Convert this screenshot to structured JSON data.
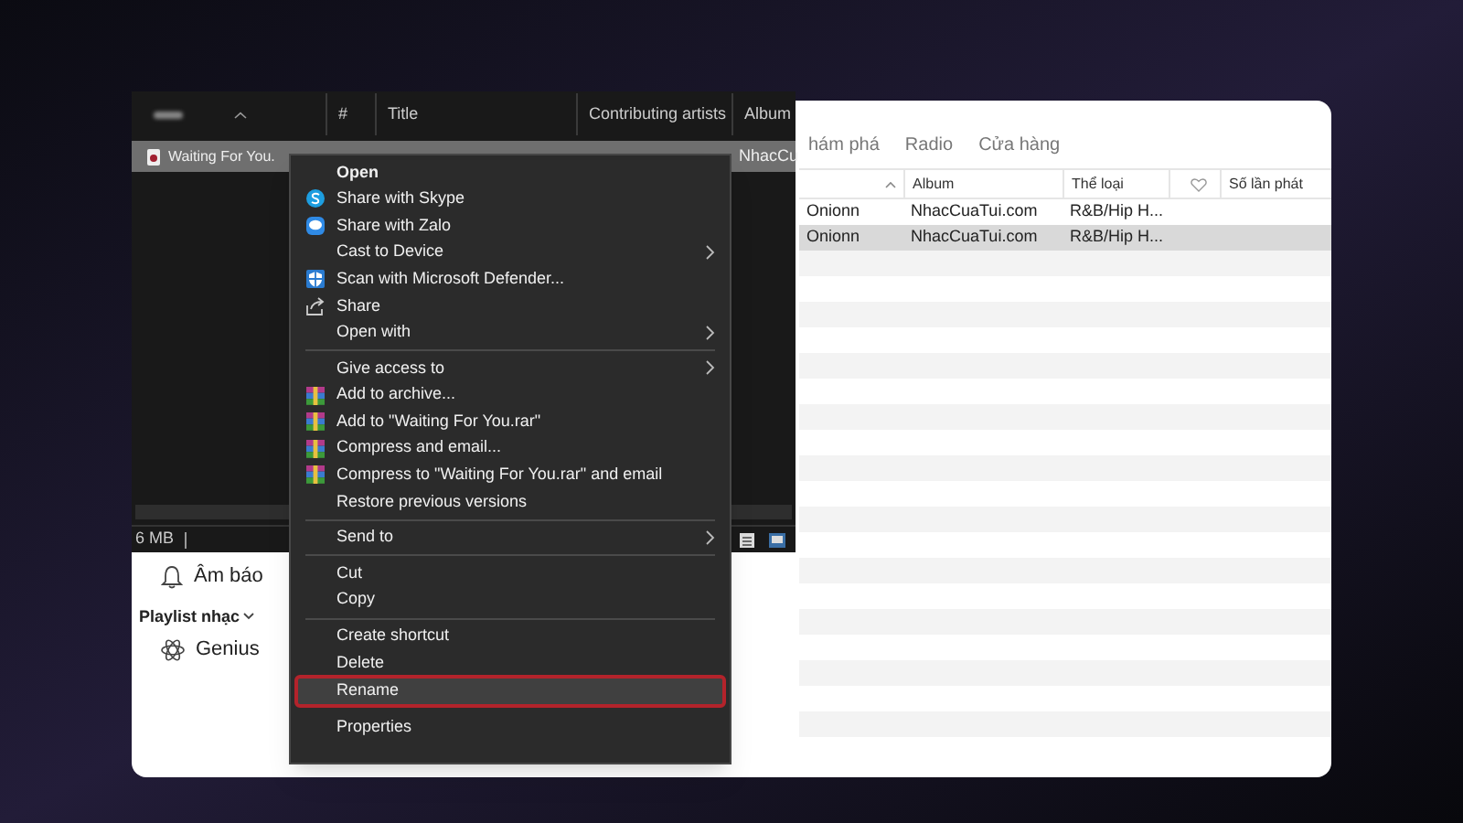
{
  "music_app": {
    "tabs": [
      {
        "label": "hám phá",
        "selected": false
      },
      {
        "label": "Radio",
        "selected": false
      },
      {
        "label": "Cửa hàng",
        "selected": false
      }
    ],
    "columns": [
      {
        "kind": "sort"
      },
      {
        "label": "Album",
        "kind": "text"
      },
      {
        "label": "Thể loại",
        "kind": "text"
      },
      {
        "kind": "heart"
      },
      {
        "label": "Số lần phát",
        "kind": "text"
      }
    ],
    "rows": [
      {
        "cells": [
          "Onionn",
          "NhacCuaTui.com",
          "R&B/Hip H..."
        ],
        "selected": false
      },
      {
        "cells": [
          "Onionn",
          "NhacCuaTui.com",
          "R&B/Hip H..."
        ],
        "selected": true
      }
    ],
    "sidebar": [
      {
        "kind": "alert_item",
        "label": "Âm báo"
      },
      {
        "kind": "heading",
        "label": "Playlist nhạc"
      },
      {
        "kind": "playlist_item",
        "label": "Genius"
      }
    ]
  },
  "explorer": {
    "columns": [
      "#",
      "Title",
      "Contributing artists",
      "Album"
    ],
    "file": {
      "name": "Waiting For You.",
      "album": "NhacCu",
      "selected": true
    },
    "status": "6 MB"
  },
  "context_menu": [
    {
      "kind": "item",
      "label": "Open",
      "bold": true
    },
    {
      "kind": "circle_app",
      "label": "Share with Skype"
    },
    {
      "kind": "chat_app",
      "label": "Share with Zalo"
    },
    {
      "kind": "item",
      "label": "Cast to Device",
      "submenu": true
    },
    {
      "kind": "shield_app",
      "label": "Scan with Microsoft Defender..."
    },
    {
      "kind": "share",
      "label": "Share"
    },
    {
      "kind": "item",
      "label": "Open with",
      "submenu": true
    },
    {
      "kind": "separator"
    },
    {
      "kind": "item",
      "label": "Give access to",
      "submenu": true
    },
    {
      "kind": "archive",
      "label": "Add to archive..."
    },
    {
      "kind": "archive",
      "label": "Add to \"Waiting For You.rar\""
    },
    {
      "kind": "archive",
      "label": "Compress and email..."
    },
    {
      "kind": "archive",
      "label": "Compress to \"Waiting For You.rar\" and email"
    },
    {
      "kind": "item",
      "label": "Restore previous versions"
    },
    {
      "kind": "separator"
    },
    {
      "kind": "item",
      "label": "Send to",
      "submenu": true
    },
    {
      "kind": "separator"
    },
    {
      "kind": "item",
      "label": "Cut"
    },
    {
      "kind": "item",
      "label": "Copy"
    },
    {
      "kind": "separator"
    },
    {
      "kind": "item",
      "label": "Create shortcut"
    },
    {
      "kind": "item",
      "label": "Delete"
    },
    {
      "kind": "item",
      "label": "Rename",
      "highlighted": true
    },
    {
      "kind": "gap"
    },
    {
      "kind": "item",
      "label": "Properties"
    }
  ]
}
